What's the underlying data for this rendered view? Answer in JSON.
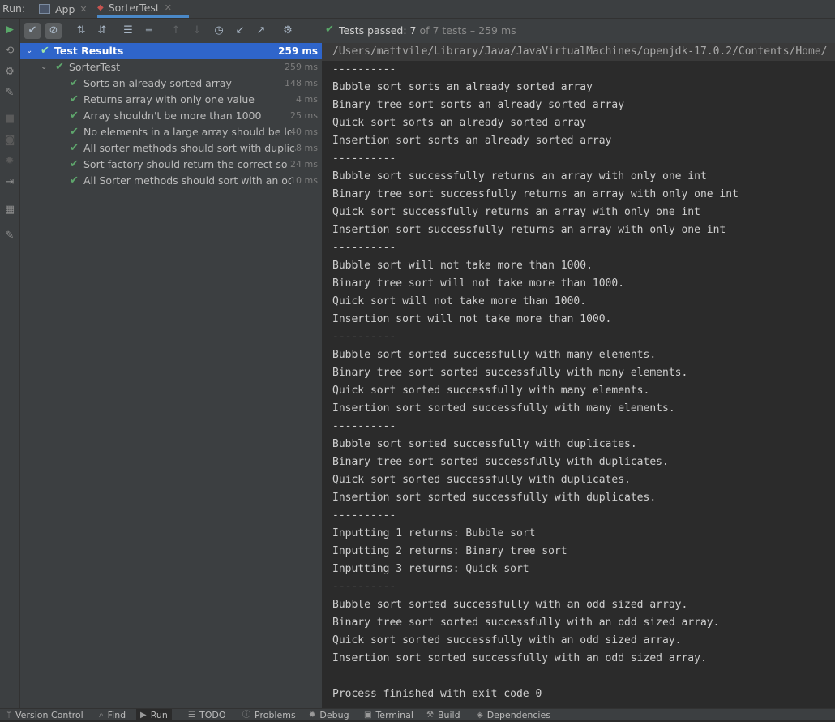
{
  "runbar": {
    "run_label": "Run:",
    "tabs": [
      {
        "label": "App"
      },
      {
        "label": "SorterTest"
      }
    ]
  },
  "status": {
    "bold": "Tests passed: 7",
    "dim": " of 7 tests – 259 ms"
  },
  "tree": [
    {
      "label": "Test Results",
      "ms": "259 ms"
    },
    {
      "label": "SorterTest",
      "ms": "259 ms"
    },
    {
      "label": "Sorts an already sorted array",
      "ms": "148 ms"
    },
    {
      "label": "Returns array with only one value",
      "ms": "4 ms"
    },
    {
      "label": "Array shouldn't be more than 1000",
      "ms": "25 ms"
    },
    {
      "label": "No elements in a large array should be lost in",
      "ms": "40 ms"
    },
    {
      "label": "All sorter methods should sort with duplicates",
      "ms": "8 ms"
    },
    {
      "label": "Sort factory should return the correct sorter",
      "ms": "24 ms"
    },
    {
      "label": "All Sorter methods should sort with an odd ar",
      "ms": "10 ms"
    }
  ],
  "console": {
    "path": "/Users/mattvile/Library/Java/JavaVirtualMachines/openjdk-17.0.2/Contents/Home/",
    "lines": [
      "----------",
      "Bubble sort sorts an already sorted array",
      "Binary tree sort sorts an already sorted array",
      "Quick sort sorts an already sorted array",
      "Insertion sort sorts an already sorted array",
      "----------",
      "Bubble sort successfully returns an array with only one int",
      "Binary tree sort successfully returns an array with only one int",
      "Quick sort successfully returns an array with only one int",
      "Insertion sort successfully returns an array with only one int",
      "----------",
      "Bubble sort will not take more than 1000.",
      "Binary tree sort will not take more than 1000.",
      "Quick sort will not take more than 1000.",
      "Insertion sort will not take more than 1000.",
      "----------",
      "Bubble sort sorted successfully with many elements.",
      "Binary tree sort sorted successfully with many elements.",
      "Quick sort sorted successfully with many elements.",
      "Insertion sort sorted successfully with many elements.",
      "----------",
      "Bubble sort sorted successfully with duplicates.",
      "Binary tree sort sorted successfully with duplicates.",
      "Quick sort sorted successfully with duplicates.",
      "Insertion sort sorted successfully with duplicates.",
      "----------",
      "Inputting 1 returns: Bubble sort",
      "Inputting 2 returns: Binary tree sort",
      "Inputting 3 returns: Quick sort",
      "----------",
      "Bubble sort sorted successfully with an odd sized array.",
      "Binary tree sort sorted successfully with an odd sized array.",
      "Quick sort sorted successfully with an odd sized array.",
      "Insertion sort sorted successfully with an odd sized array.",
      "",
      "Process finished with exit code 0"
    ]
  },
  "bottombar": [
    {
      "label": "Version Control",
      "icon": "branch-icon"
    },
    {
      "label": "Find",
      "icon": "search-icon"
    },
    {
      "label": "Run",
      "icon": "play-icon"
    },
    {
      "label": "TODO",
      "icon": "list-icon"
    },
    {
      "label": "Problems",
      "icon": "info-icon"
    },
    {
      "label": "Debug",
      "icon": "bug-icon"
    },
    {
      "label": "Terminal",
      "icon": "terminal-icon"
    },
    {
      "label": "Build",
      "icon": "hammer-icon"
    },
    {
      "label": "Dependencies",
      "icon": "layers-icon"
    }
  ],
  "colors": {
    "accent": "#2f65ca",
    "pass": "#5ea66c",
    "run": "#59a869"
  }
}
